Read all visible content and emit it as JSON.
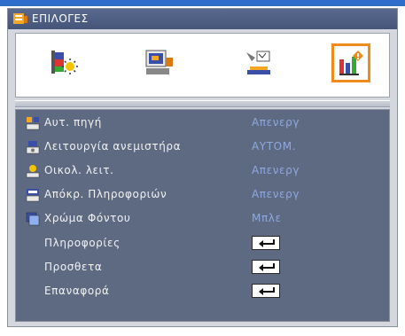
{
  "window": {
    "title": "ΕΠΙΛΟΓΕΣ",
    "title_icon": "options-menu-icon"
  },
  "tabs": [
    {
      "icon": "image-color-icon",
      "active": false
    },
    {
      "icon": "display-screen-icon",
      "active": false
    },
    {
      "icon": "setup-projector-icon",
      "active": false
    },
    {
      "icon": "options-bars-icon",
      "active": true
    }
  ],
  "menu": {
    "items": [
      {
        "icon": "source-lock-icon",
        "label": "Αυτ. πηγή",
        "value": "Απενεργ"
      },
      {
        "icon": "fan-icon",
        "label": "Λειτουργία ανεμιστήρα",
        "value": "ΑΥΤΟΜ."
      },
      {
        "icon": "eco-mode-icon",
        "label": "Οικολ. λειτ.",
        "value": "Απενεργ"
      },
      {
        "icon": "info-hide-icon",
        "label": "Απόκρ. Πληροφοριών",
        "value": "Απενεργ"
      },
      {
        "icon": "background-color-icon",
        "label": "Χρώμα Φόντου",
        "value": "Μπλε"
      },
      {
        "icon": "",
        "label": "Πληροφορίες",
        "value": "enter"
      },
      {
        "icon": "",
        "label": "Προσθετα",
        "value": "enter"
      },
      {
        "icon": "",
        "label": "Επαναφορά",
        "value": "enter"
      }
    ]
  },
  "colors": {
    "accent": "#f08a1c",
    "list_bg": "#5e6a82",
    "value_text": "#8fa8e0",
    "title_bg": "#45557a"
  }
}
